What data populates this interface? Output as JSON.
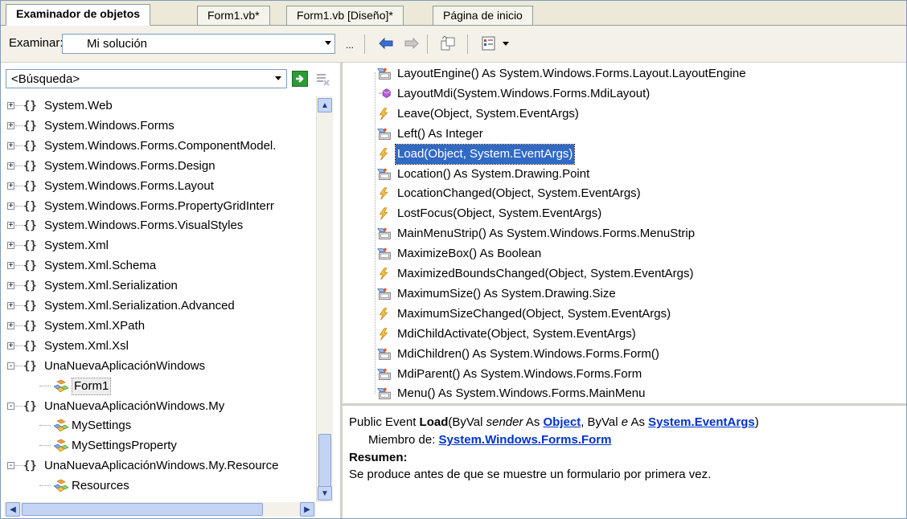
{
  "tabs": [
    {
      "label": "Examinador de objetos",
      "active": true
    },
    {
      "label": "Form1.vb*",
      "active": false
    },
    {
      "label": "Form1.vb [Diseño]*",
      "active": false
    },
    {
      "label": "Página de inicio",
      "active": false
    }
  ],
  "toolbar": {
    "browse_label": "Examinar:",
    "browse_value": "Mi solución",
    "ellipsis": "..."
  },
  "search": {
    "value": "<Búsqueda>"
  },
  "tree": [
    {
      "label": "System.Web",
      "toggle": "+"
    },
    {
      "label": "System.Windows.Forms",
      "toggle": "+"
    },
    {
      "label": "System.Windows.Forms.ComponentModel.",
      "toggle": "+"
    },
    {
      "label": "System.Windows.Forms.Design",
      "toggle": "+"
    },
    {
      "label": "System.Windows.Forms.Layout",
      "toggle": "+"
    },
    {
      "label": "System.Windows.Forms.PropertyGridInterr",
      "toggle": "+"
    },
    {
      "label": "System.Windows.Forms.VisualStyles",
      "toggle": "+"
    },
    {
      "label": "System.Xml",
      "toggle": "+"
    },
    {
      "label": "System.Xml.Schema",
      "toggle": "+"
    },
    {
      "label": "System.Xml.Serialization",
      "toggle": "+"
    },
    {
      "label": "System.Xml.Serialization.Advanced",
      "toggle": "+"
    },
    {
      "label": "System.Xml.XPath",
      "toggle": "+"
    },
    {
      "label": "System.Xml.Xsl",
      "toggle": "+"
    },
    {
      "label": "UnaNuevaAplicaciónWindows",
      "toggle": "-"
    },
    {
      "label": "Form1",
      "child": true,
      "icon": "form-class-icon"
    },
    {
      "label": "UnaNuevaAplicaciónWindows.My",
      "toggle": "-"
    },
    {
      "label": "MySettings",
      "child": true,
      "icon": "class-icon"
    },
    {
      "label": "MySettingsProperty",
      "child": true,
      "icon": "class-icon"
    },
    {
      "label": "UnaNuevaAplicaciónWindows.My.Resource",
      "toggle": "-"
    },
    {
      "label": "Resources",
      "child": true,
      "icon": "class-icon"
    }
  ],
  "members": [
    {
      "text": "LayoutEngine() As System.Windows.Forms.Layout.LayoutEngine",
      "icon": "property-icon"
    },
    {
      "text": "LayoutMdi(System.Windows.Forms.MdiLayout)",
      "icon": "method-icon"
    },
    {
      "text": "Leave(Object, System.EventArgs)",
      "icon": "event-icon"
    },
    {
      "text": "Left() As Integer",
      "icon": "property-icon"
    },
    {
      "text": "Load(Object, System.EventArgs)",
      "icon": "event-icon",
      "selected": true
    },
    {
      "text": "Location() As System.Drawing.Point",
      "icon": "property-icon"
    },
    {
      "text": "LocationChanged(Object, System.EventArgs)",
      "icon": "event-icon"
    },
    {
      "text": "LostFocus(Object, System.EventArgs)",
      "icon": "event-icon"
    },
    {
      "text": "MainMenuStrip() As System.Windows.Forms.MenuStrip",
      "icon": "property-icon"
    },
    {
      "text": "MaximizeBox() As Boolean",
      "icon": "property-icon"
    },
    {
      "text": "MaximizedBoundsChanged(Object, System.EventArgs)",
      "icon": "event-icon"
    },
    {
      "text": "MaximumSize() As System.Drawing.Size",
      "icon": "property-icon"
    },
    {
      "text": "MaximumSizeChanged(Object, System.EventArgs)",
      "icon": "event-icon"
    },
    {
      "text": "MdiChildActivate(Object, System.EventArgs)",
      "icon": "event-icon"
    },
    {
      "text": "MdiChildren() As System.Windows.Forms.Form()",
      "icon": "property-icon"
    },
    {
      "text": "MdiParent() As System.Windows.Forms.Form",
      "icon": "property-icon"
    },
    {
      "text": "Menu() As System.Windows.Forms.MainMenu",
      "icon": "property-icon"
    }
  ],
  "description": {
    "sig_prefix": "Public Event ",
    "sig_name": "Load",
    "sig_open": "(ByVal ",
    "sig_param1": "sender",
    "sig_as1": " As ",
    "sig_type1": "Object",
    "sig_sep": ", ByVal ",
    "sig_param2": "e",
    "sig_as2": " As ",
    "sig_type2a": "System",
    "sig_dot": ".",
    "sig_type2b": "EventArgs",
    "sig_close": ")",
    "member_of_label": "Miembro de: ",
    "member_of_parts": [
      "System",
      "Windows",
      "Forms",
      "Form"
    ],
    "summary_label": "Resumen:",
    "summary_text": "Se produce antes de que se muestre un formulario por primera vez."
  },
  "colors": {
    "selection": "#316ac5",
    "link": "#0033cc"
  }
}
